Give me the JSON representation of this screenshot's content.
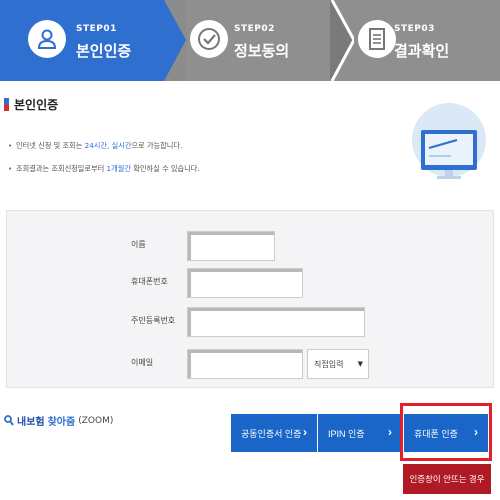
{
  "steps": [
    {
      "num": "STEP01",
      "label": "본인인증",
      "state": "active"
    },
    {
      "num": "STEP02",
      "label": "정보동의",
      "state": "inactive"
    },
    {
      "num": "STEP03",
      "label": "결과확인",
      "state": "inactive"
    }
  ],
  "section": {
    "title": "본인인증",
    "notes": [
      {
        "pre": "인터넷 신청 및 조회는 ",
        "hl": "24시간, 실시간",
        "post": "으로 가능합니다."
      },
      {
        "pre": "조회결과는 조회신청일로부터 ",
        "hl": "1개월간",
        "post": " 확인하실 수 있습니다."
      }
    ]
  },
  "form": {
    "name_label": "이름",
    "phone_label": "휴대폰번호",
    "rrn_label": "주민등록번호",
    "email_label": "이메일",
    "name_value": "",
    "phone_value": "",
    "rrn_value": "",
    "email_value": "",
    "email_domain_select": "직접입력"
  },
  "zoom": {
    "part1": "내보험",
    "part2": "찾아줌",
    "part3": "(ZOOM)"
  },
  "auth": {
    "cert": "공동인증서 인증",
    "ipin": "IPIN 인증",
    "phone": "휴대폰 인증",
    "popup_issue": "인증창이 안뜨는 경우"
  },
  "colors": {
    "active_step": "#2f6fd0",
    "inactive_step": "#8f8f8f",
    "button": "#1a66c8",
    "highlight": "#e3202a",
    "popup_button": "#b01a24"
  }
}
